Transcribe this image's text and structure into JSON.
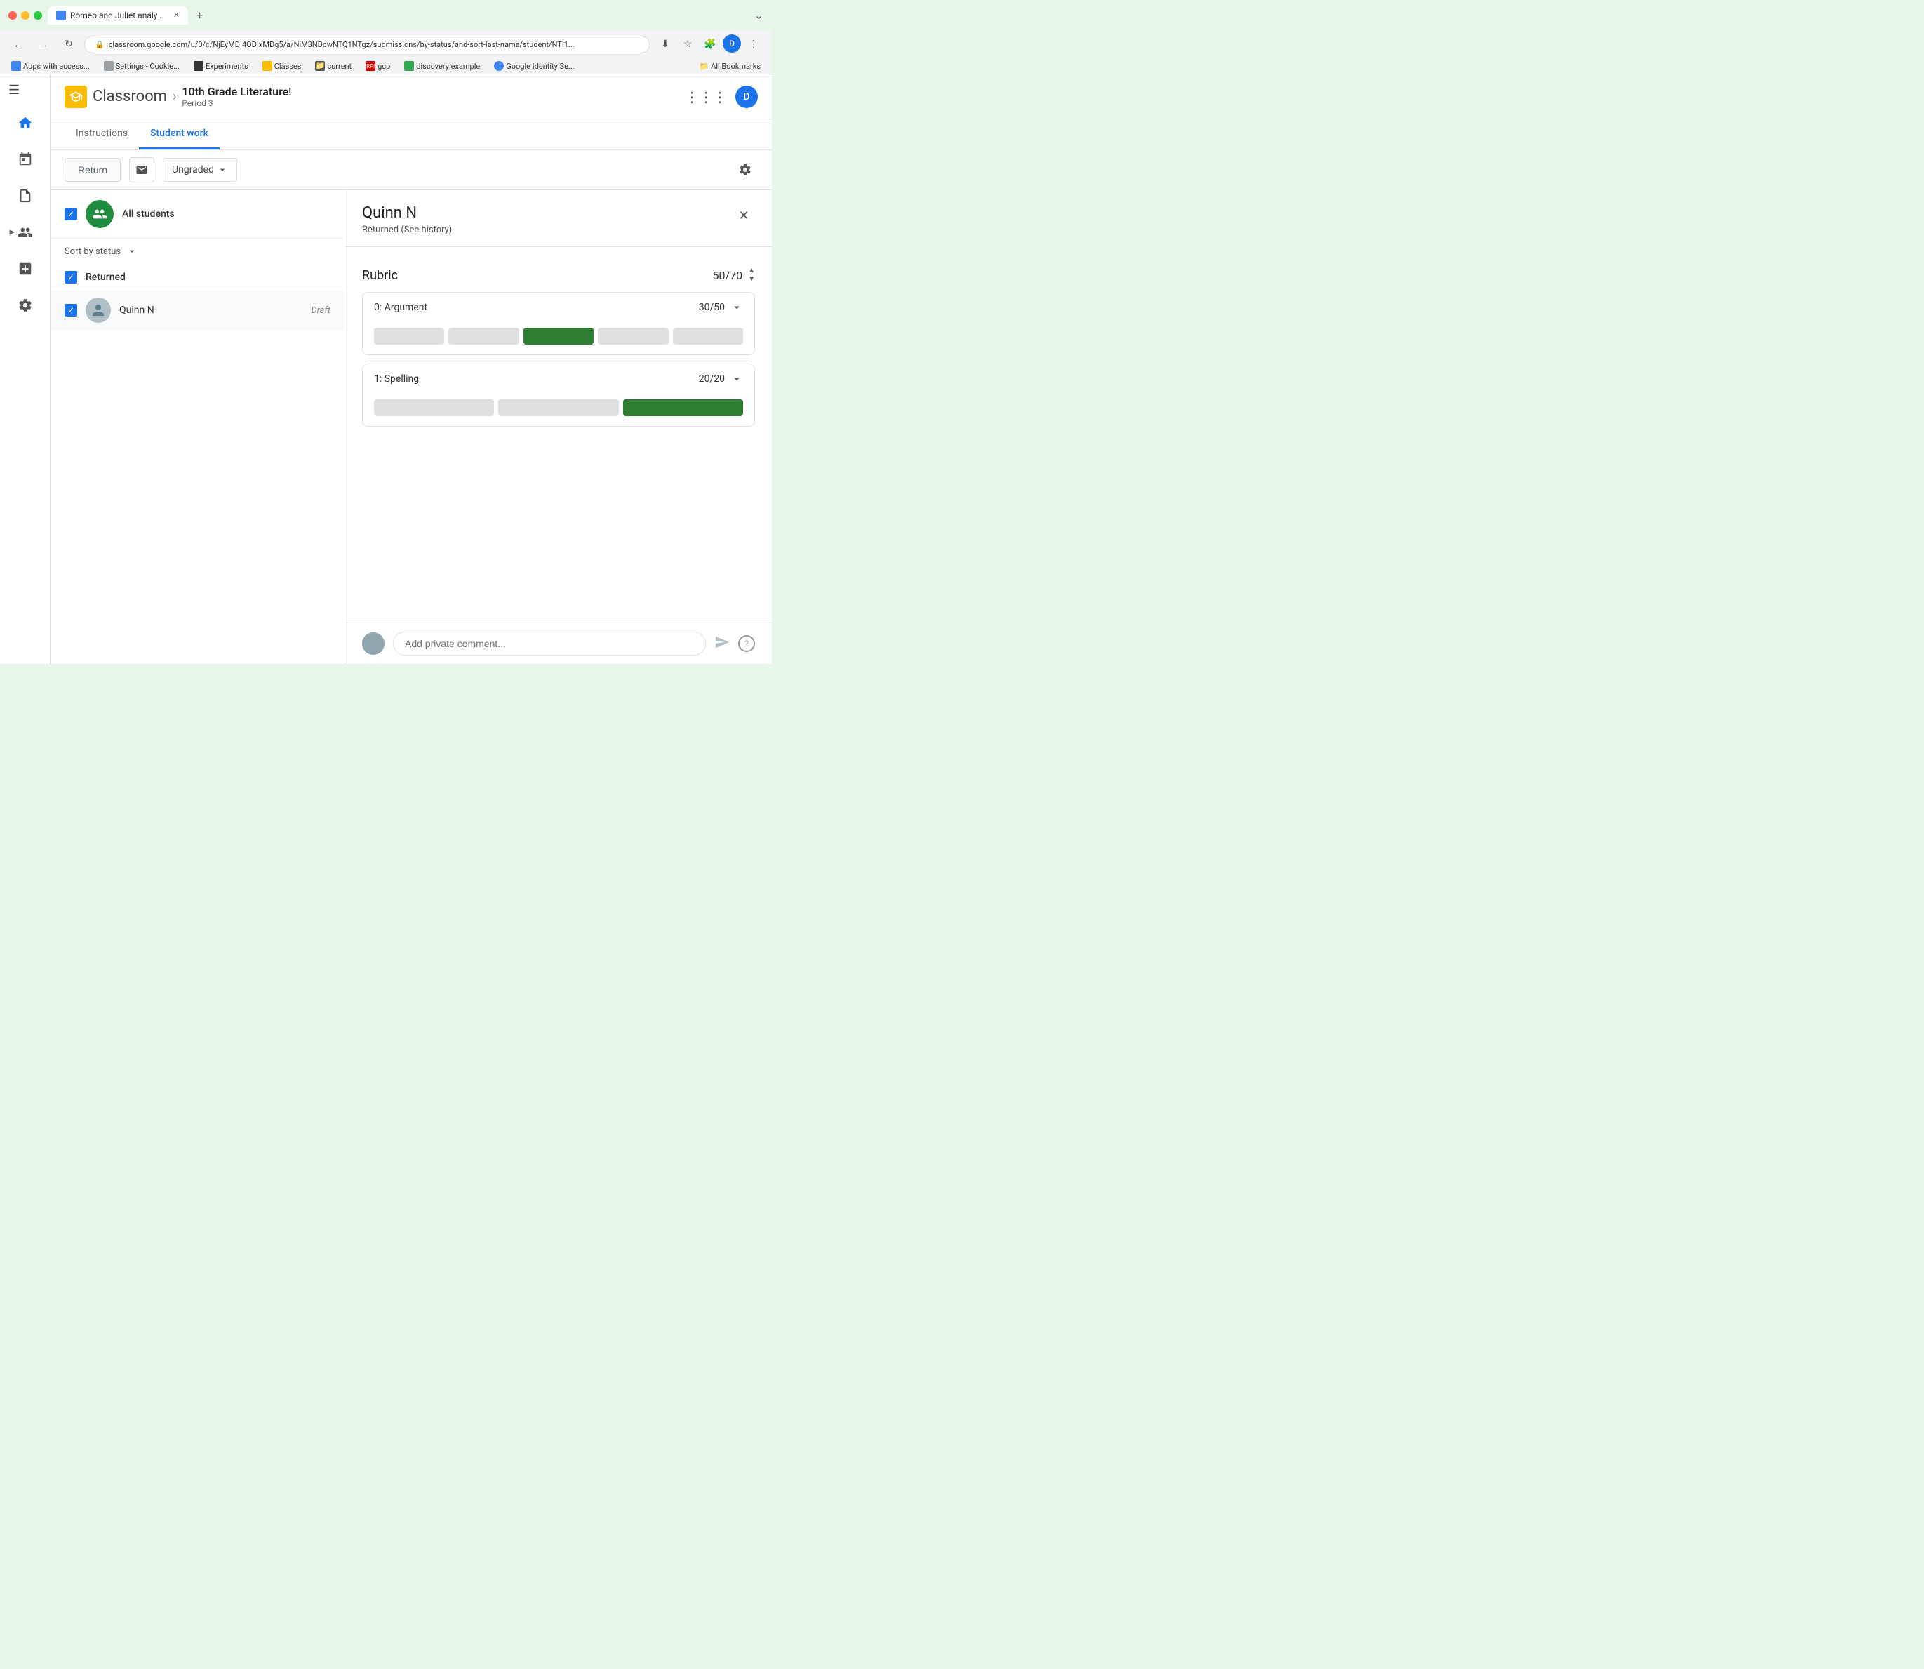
{
  "browser": {
    "tab_label": "Romeo and Juliet analysis.",
    "url": "classroom.google.com/u/0/c/NjEyMDI4ODIxMDg5/a/NjM3NDcwNTQ1NTgz/submissions/by-status/and-sort-last-name/student/NTI1...",
    "chevron_down": "⌄",
    "plus": "+",
    "back_arrow": "←",
    "forward_arrow": "→",
    "refresh": "↻",
    "lock_icon": "🔒",
    "extensions_icon": "🧩",
    "profile_icon": "D",
    "bookmarks": [
      {
        "label": "Apps with access...",
        "type": "g"
      },
      {
        "label": "Settings - Cookie...",
        "type": "s"
      },
      {
        "label": "Experiments",
        "type": "exp"
      },
      {
        "label": "Classes",
        "type": "cls"
      },
      {
        "label": "current",
        "type": "cur"
      },
      {
        "label": "gcp",
        "type": "rpi"
      },
      {
        "label": "discovery example",
        "type": "de"
      },
      {
        "label": "Google Identity Se...",
        "type": "gi"
      }
    ],
    "all_bookmarks": "All Bookmarks"
  },
  "header": {
    "classroom_initial": "C",
    "classroom_label": "Classroom",
    "breadcrumb_arrow": "›",
    "course_name": "10th Grade Literature!",
    "course_period": "Period 3",
    "avatar_initial": "D"
  },
  "tabs": {
    "instructions": "Instructions",
    "student_work": "Student work"
  },
  "toolbar": {
    "return_label": "Return",
    "grade_label": "Ungraded"
  },
  "student_list": {
    "all_students_label": "All students",
    "sort_label": "Sort by status",
    "section_returned": "Returned",
    "student_name": "Quinn N",
    "student_status": "Draft"
  },
  "detail": {
    "student_name": "Quinn N",
    "student_status": "Returned (See history)",
    "rubric_title": "Rubric",
    "rubric_score": "50/70",
    "criteria": [
      {
        "name": "0: Argument",
        "score": "30/50",
        "bars": [
          {
            "type": "empty"
          },
          {
            "type": "empty"
          },
          {
            "type": "active"
          },
          {
            "type": "empty"
          },
          {
            "type": "empty"
          }
        ]
      },
      {
        "name": "1: Spelling",
        "score": "20/20",
        "bars": [
          {
            "type": "empty"
          },
          {
            "type": "empty"
          },
          {
            "type": "active"
          }
        ]
      }
    ],
    "comment_placeholder": "Add private comment...",
    "help_label": "?"
  },
  "sidebar": {
    "home_icon": "⌂",
    "calendar_icon": "📅",
    "assignment_icon": "📄",
    "people_icon": "👥",
    "add_icon": "⊕",
    "settings_icon": "⚙"
  }
}
